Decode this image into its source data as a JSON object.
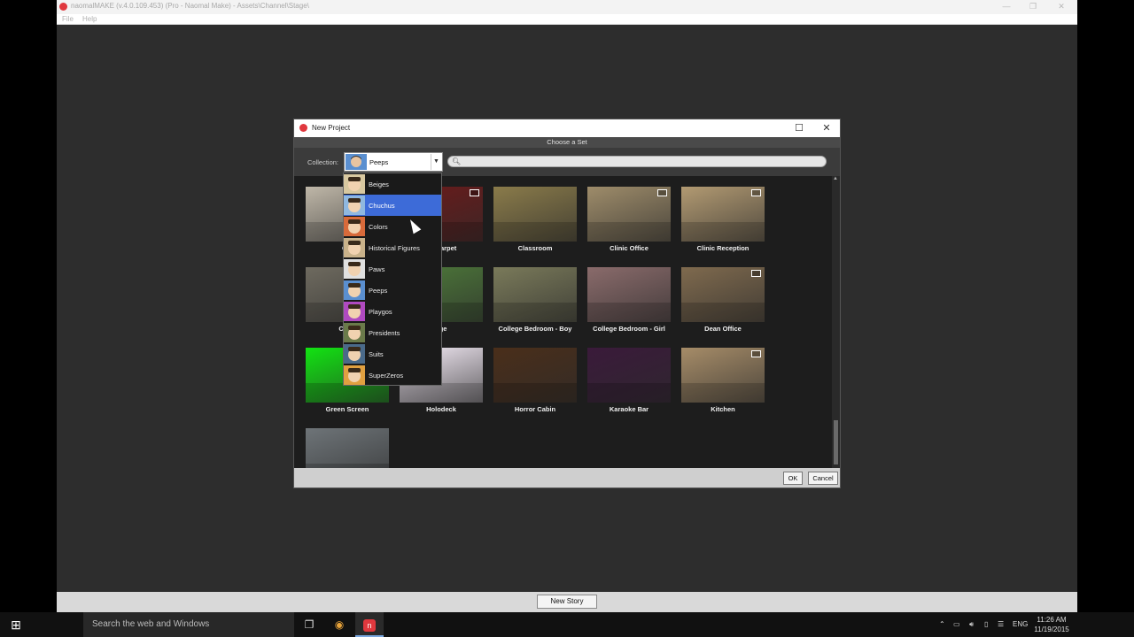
{
  "app": {
    "title": "naomalMAKE (v.4.0.109.453) (Pro - Naomal Make) - Assets\\Channel\\Stage\\",
    "menu": [
      "File",
      "Help"
    ],
    "window_controls": [
      "—",
      "❐",
      "✕"
    ],
    "new_story_label": "New Story"
  },
  "dialog": {
    "title": "New Project",
    "subtitle": "Choose a Set",
    "collection_label": "Collection:",
    "collection_value": "Peeps",
    "search_placeholder": "",
    "ok_label": "OK",
    "cancel_label": "Cancel",
    "window_controls": [
      "☐",
      "✕"
    ]
  },
  "dropdown": {
    "selected": "Chuchus",
    "items": [
      "Beiges",
      "Chuchus",
      "Colors",
      "Historical Figures",
      "Paws",
      "Peeps",
      "Playgos",
      "Presidents",
      "Suits",
      "SuperZeros"
    ]
  },
  "sets": [
    {
      "label": "Cafe",
      "visible_label": "Caf",
      "color": "#bfb7a8"
    },
    {
      "label": "Red Carpet",
      "visible_label": "ed Carpet",
      "color": "#6b1a1a"
    },
    {
      "label": "Classroom",
      "visible_label": "Classroom",
      "color": "#8a7b4a"
    },
    {
      "label": "Clinic Office",
      "visible_label": "Clinic Office",
      "color": "#9e8c6a"
    },
    {
      "label": "Clinic Reception",
      "visible_label": "Clinic Reception",
      "color": "#b29a72"
    },
    {
      "label": "Coffee Shop",
      "visible_label": "Coffe",
      "color": "#6e6a5f"
    },
    {
      "label": "College",
      "visible_label": "ege",
      "color": "#4e7a3a"
    },
    {
      "label": "College Bedroom - Boy",
      "visible_label": "College Bedroom - Boy",
      "color": "#7a7a5a"
    },
    {
      "label": "College Bedroom - Girl",
      "visible_label": "College Bedroom - Girl",
      "color": "#8a6b6b"
    },
    {
      "label": "Dean Office",
      "visible_label": "Dean Office",
      "color": "#7f6a4e"
    },
    {
      "label": "Green Screen",
      "visible_label": "Green Screen",
      "color": "#12e312"
    },
    {
      "label": "Holodeck",
      "visible_label": "Holodeck",
      "color": "#f7eef9"
    },
    {
      "label": "Horror Cabin",
      "visible_label": "Horror Cabin",
      "color": "#4a2e1a"
    },
    {
      "label": "Karaoke Bar",
      "visible_label": "Karaoke Bar",
      "color": "#3a1a3a"
    },
    {
      "label": "Kitchen",
      "visible_label": "Kitchen",
      "color": "#a68c68"
    },
    {
      "label": "",
      "visible_label": "",
      "color": "#6e7478"
    }
  ],
  "taskbar": {
    "search_text": "Search the web and Windows",
    "language": "ENG",
    "time": "11:26 AM",
    "date": "11/19/2015"
  }
}
